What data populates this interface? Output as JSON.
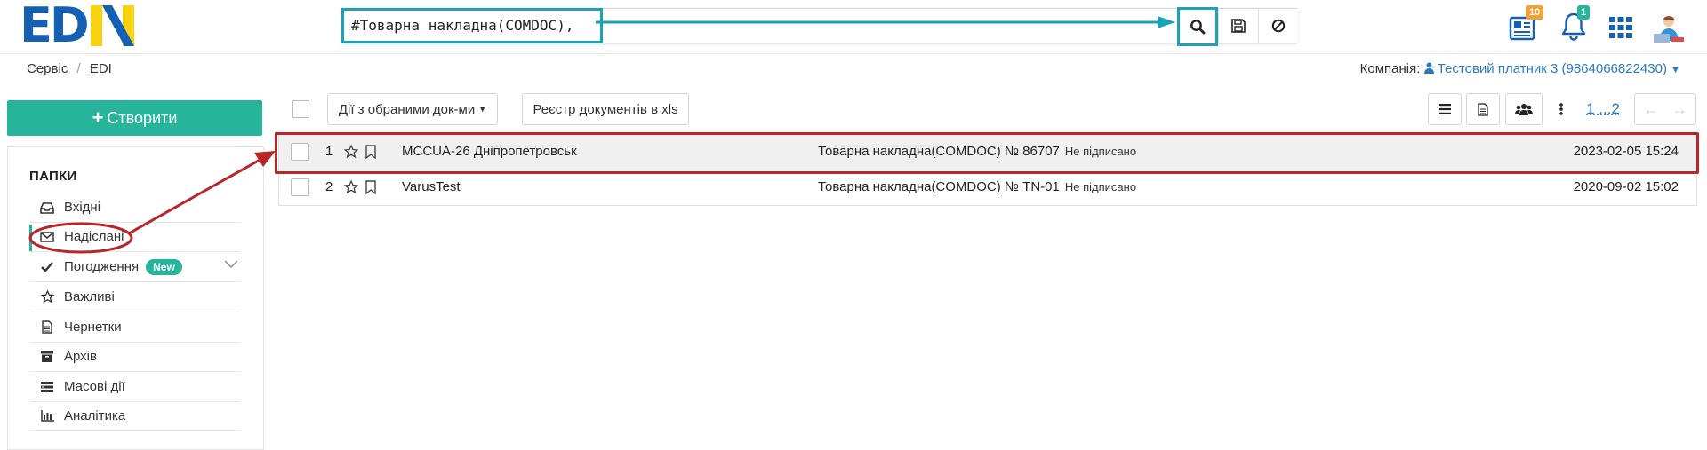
{
  "header": {
    "logo": "EDIN",
    "search_query": "#Товарна накладна(COMDOC),",
    "notifications": {
      "news_count": "10",
      "bell_count": "1"
    },
    "icons": [
      "search-icon",
      "save-icon",
      "clear-icon",
      "news-icon",
      "bell-icon",
      "apps-grid-icon",
      "avatar"
    ]
  },
  "breadcrumb": {
    "items": [
      "Сервіс",
      "EDI"
    ]
  },
  "company": {
    "label": "Компанія:",
    "name": "Тестовий платник 3 (9864066822430)"
  },
  "sidebar": {
    "create_label": "Створити",
    "folders_title": "ПАПКИ",
    "items": [
      {
        "label": "Вхідні",
        "icon": "inbox-icon"
      },
      {
        "label": "Надіслані",
        "icon": "envelope-icon"
      },
      {
        "label": "Погодження",
        "icon": "check-icon",
        "badge": "New"
      },
      {
        "label": "Важливі",
        "icon": "star-icon"
      },
      {
        "label": "Чернетки",
        "icon": "file-icon"
      },
      {
        "label": "Архів",
        "icon": "archive-icon"
      },
      {
        "label": "Масові дії",
        "icon": "list-icon"
      },
      {
        "label": "Аналітика",
        "icon": "bar-chart-icon"
      }
    ]
  },
  "toolbar": {
    "bulk_actions_label": "Дії з обраними док-ми",
    "export_label": "Реєстр документів в xls",
    "pagination": "1 ...2"
  },
  "documents": [
    {
      "num": "1",
      "partner": "MCCUA-26 Дніпропетровськ",
      "doc_type": "Товарна накладна(COMDOC) № 86707",
      "status": "Не підписано",
      "date": "2023-02-05 15:24"
    },
    {
      "num": "2",
      "partner": "VarusTest",
      "doc_type": "Товарна накладна(COMDOC) № TN-01",
      "status": "Не підписано",
      "date": "2020-09-02 15:02"
    }
  ],
  "colors": {
    "accent": "#26b59b",
    "highlight_teal": "#1ca2b4",
    "highlight_red": "#b8262a",
    "link": "#2a7bbf"
  }
}
